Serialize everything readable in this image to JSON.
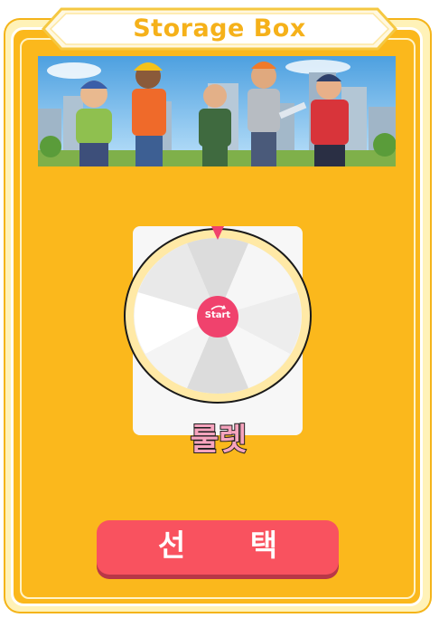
{
  "dialog": {
    "title": "Storage Box"
  },
  "wheel": {
    "center_label": "Start",
    "name": "룰렛"
  },
  "actions": {
    "select_label": "선 택"
  },
  "colors": {
    "background": "#fbb81c",
    "frame": "#fff2b8",
    "title_text": "#f5b11a",
    "select_button": "#f9525f",
    "start_button": "#f0426d",
    "wheel_rim": "#ffe9a6",
    "pointer": "#f0426d"
  }
}
